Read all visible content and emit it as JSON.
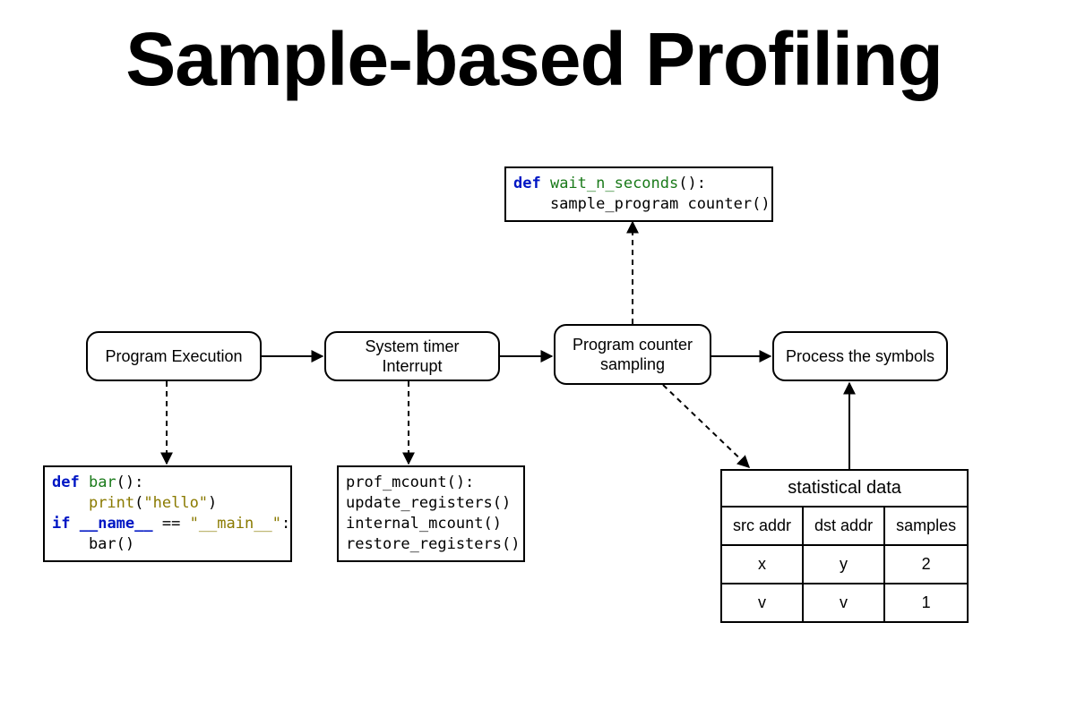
{
  "title": "Sample-based Profiling",
  "nodes": {
    "exec": "Program Execution",
    "timer": "System timer Interrupt",
    "pcs": "Program counter\nsampling",
    "process": "Process the symbols"
  },
  "code": {
    "wait": {
      "line1_kw": "def",
      "line1_fn": " wait_n_seconds",
      "line1_rest": "():",
      "line2": "    sample_program counter()"
    },
    "bar": {
      "l1_kw": "def",
      "l1_fn": " bar",
      "l1_rest": "():",
      "l2a": "    ",
      "l2_fn": "print",
      "l2_paren_open": "(",
      "l2_str": "\"hello\"",
      "l2_paren_close": ")",
      "l3_kw": "if",
      "l3_sp1": " ",
      "l3_var": "__name__",
      "l3_eq": " == ",
      "l3_str": "\"__main__\"",
      "l3_colon": ":",
      "l4": "    bar()"
    },
    "prof": {
      "l1": "prof_mcount():",
      "l2": "update_registers()",
      "l3": "internal_mcount()",
      "l4": "restore_registers()"
    }
  },
  "table": {
    "caption": "statistical data",
    "headers": [
      "src addr",
      "dst addr",
      "samples"
    ],
    "rows": [
      [
        "x",
        "y",
        "2"
      ],
      [
        "v",
        "v",
        "1"
      ]
    ]
  }
}
